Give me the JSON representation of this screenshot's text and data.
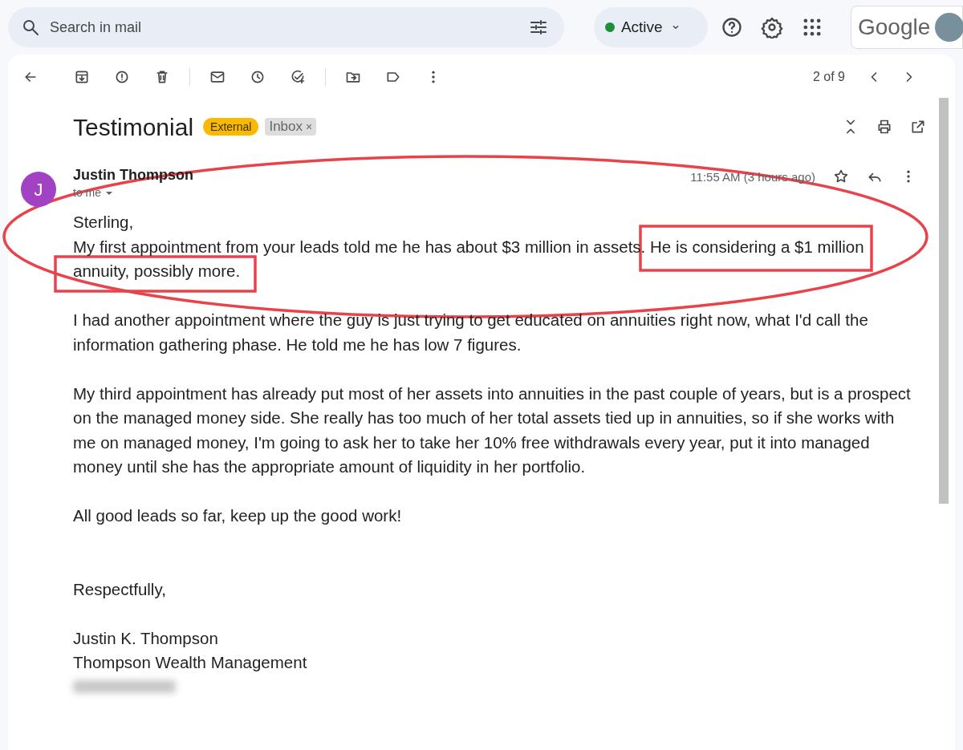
{
  "search": {
    "placeholder": "Search in mail"
  },
  "status": {
    "label": "Active"
  },
  "brand": {
    "logo": "Google"
  },
  "toolbar": {
    "pagination": "2 of 9"
  },
  "message": {
    "subject": "Testimonial",
    "labels": [
      {
        "kind": "external",
        "text": "External"
      },
      {
        "kind": "inbox",
        "text": "Inbox",
        "remove": "×"
      }
    ],
    "sender": {
      "initial": "J",
      "name": "Justin Thompson",
      "recipient": "to me",
      "time": "11:55 AM (3 hours ago)"
    },
    "paragraphs": [
      "Sterling,\nMy first appointment from your leads told me he has about $3 million in assets. He is considering a $1 million annuity, possibly more.",
      "I had another appointment where the guy is just trying to get educated on annuities right now, what I'd call the information gathering phase.  He told me he has low 7 figures.",
      "My third appointment has already put most of her assets into annuities in the past couple of years, but is a prospect on the managed money side.  She really has too much of her total assets tied up in annuities, so if she works with me on managed money, I'm going to ask her to take her 10% free withdrawals every year, put it into managed money until she has the appropriate amount of liquidity in her portfolio.",
      "All good leads so far, keep up the good work!"
    ],
    "closing": "Respectfully,",
    "signature": [
      "Justin K. Thompson",
      "Thompson Wealth Management"
    ]
  }
}
